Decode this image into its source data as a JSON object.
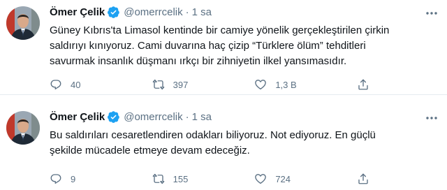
{
  "tweets": [
    {
      "name": "Ömer Çelik",
      "handle": "@omerrcelik",
      "dot": "·",
      "time": "1 sa",
      "lines": [
        "Güney Kıbrıs'ta Limasol kentinde bir camiye yönelik gerçekleştirilen çirkin",
        "saldırıyı kınıyoruz. Cami duvarına haç çizip “Türklere ölüm” tehditleri",
        "savurmak insanlık düşmanı ırkçı bir zihniyetin ilkel yansımasıdır."
      ],
      "replies": "40",
      "retweets": "397",
      "likes": "1,3 B"
    },
    {
      "name": "Ömer Çelik",
      "handle": "@omerrcelik",
      "dot": "·",
      "time": "1 sa",
      "lines": [
        "Bu saldırıları cesaretlendiren odakları biliyoruz. Not ediyoruz. En güçlü",
        "şekilde mücadele etmeye devam edeceğiz."
      ],
      "replies": "9",
      "retweets": "155",
      "likes": "724"
    }
  ],
  "colors": {
    "verified": "#1da1f2",
    "secondary_text": "#5b7083",
    "divider": "#e6ecf0"
  }
}
